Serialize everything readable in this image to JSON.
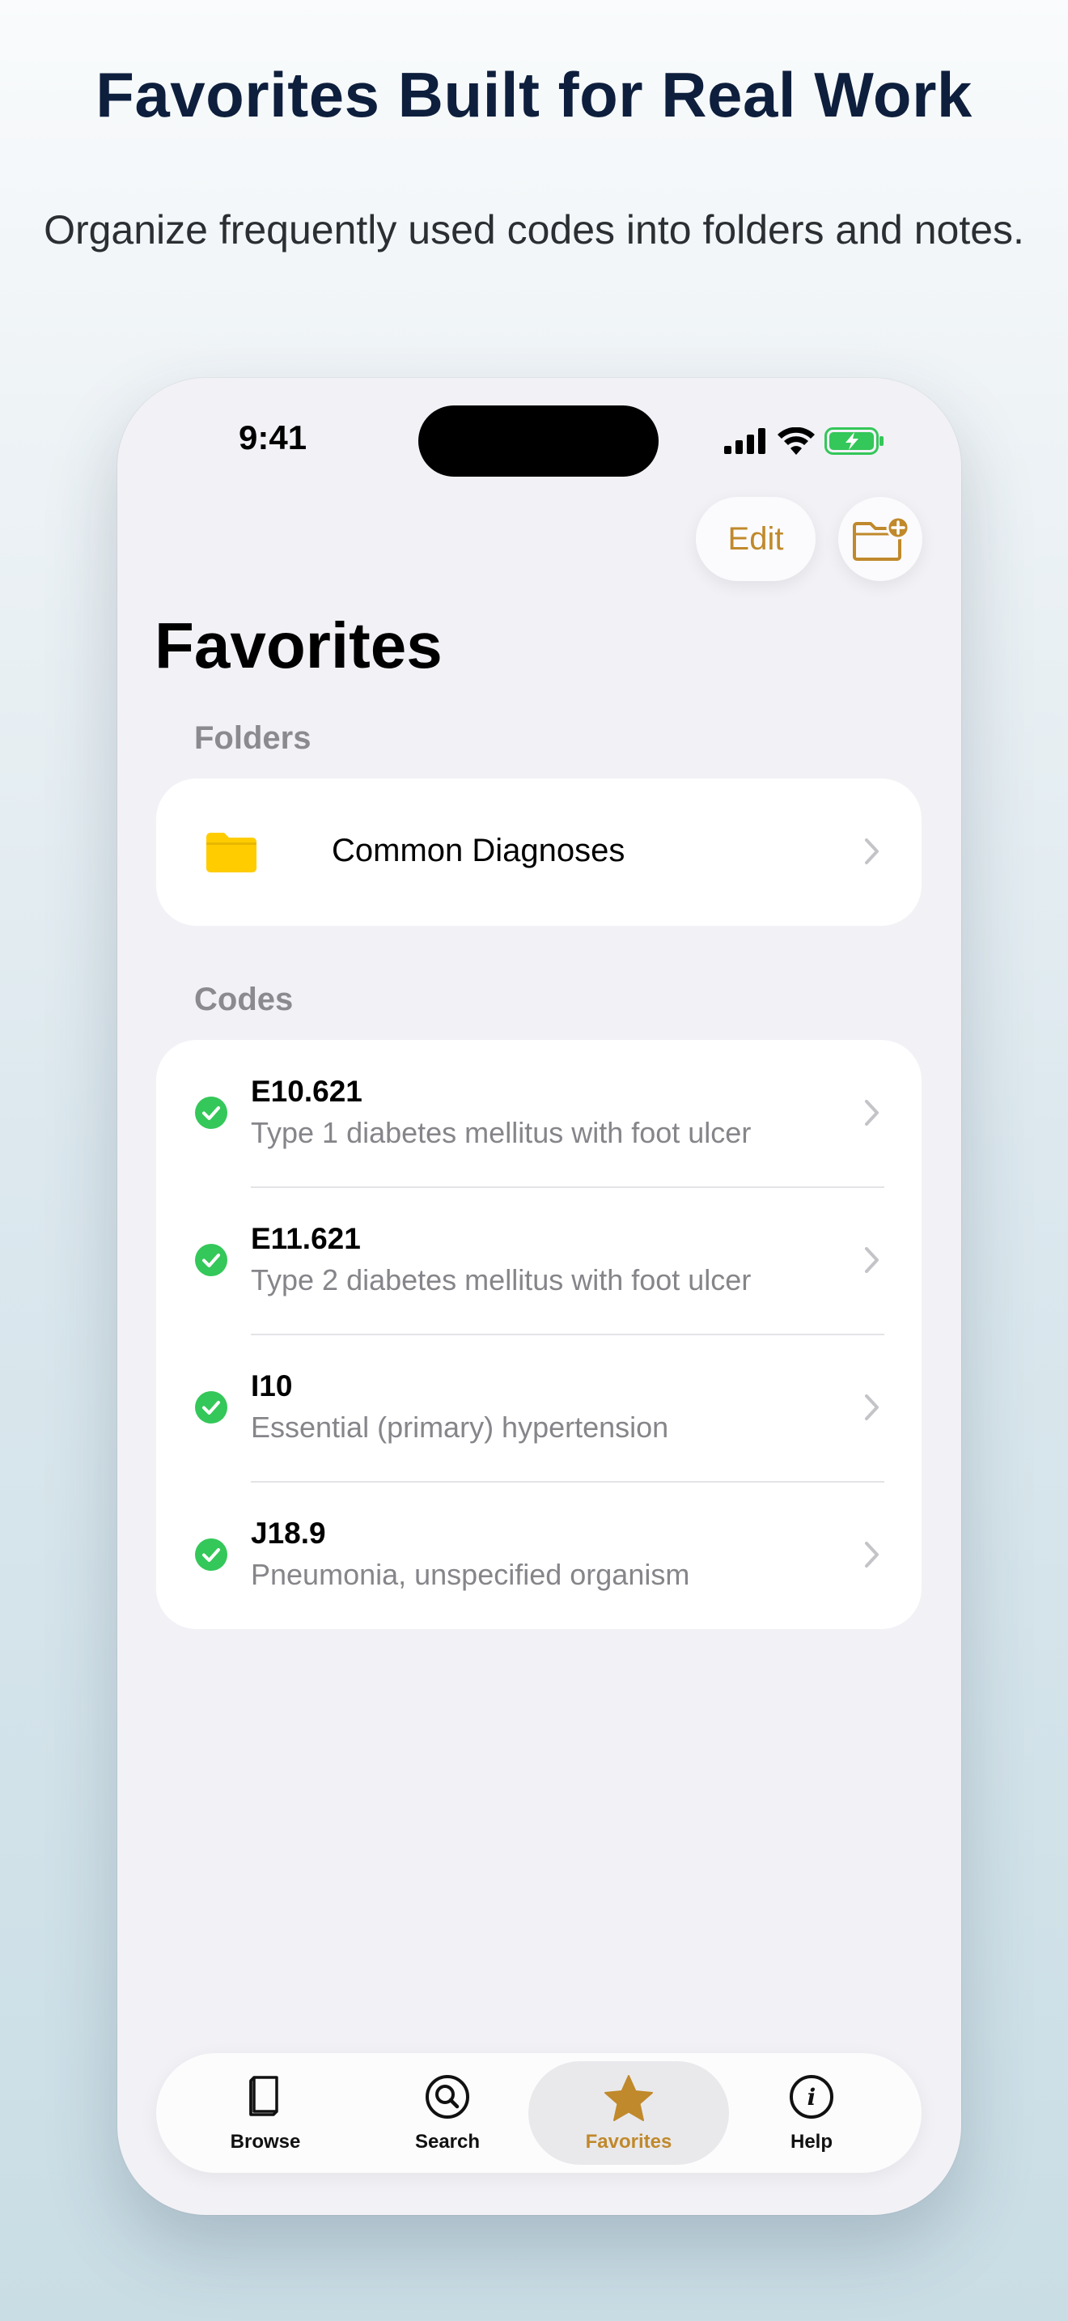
{
  "promo": {
    "headline": "Favorites Built for Real Work",
    "subheadline": "Organize frequently used codes into folders and notes."
  },
  "status_bar": {
    "time": "9:41"
  },
  "nav": {
    "edit_label": "Edit"
  },
  "page": {
    "title": "Favorites"
  },
  "folders": {
    "section_label": "Folders",
    "items": [
      {
        "name": "Common Diagnoses"
      }
    ]
  },
  "codes": {
    "section_label": "Codes",
    "items": [
      {
        "code": "E10.621",
        "description": "Type 1 diabetes mellitus with foot ulcer"
      },
      {
        "code": "E11.621",
        "description": "Type 2 diabetes mellitus with foot ulcer"
      },
      {
        "code": "I10",
        "description": "Essential (primary) hypertension"
      },
      {
        "code": "J18.9",
        "description": "Pneumonia, unspecified organism"
      }
    ]
  },
  "tab_bar": {
    "tabs": [
      {
        "label": "Browse",
        "icon": "book-icon"
      },
      {
        "label": "Search",
        "icon": "magnifier-icon"
      },
      {
        "label": "Favorites",
        "icon": "star-icon",
        "active": true
      },
      {
        "label": "Help",
        "icon": "info-icon"
      }
    ]
  },
  "colors": {
    "accent": "#c0892b",
    "headline": "#0e1f3d",
    "check_green": "#34c759",
    "folder_yellow": "#ffcc00"
  }
}
